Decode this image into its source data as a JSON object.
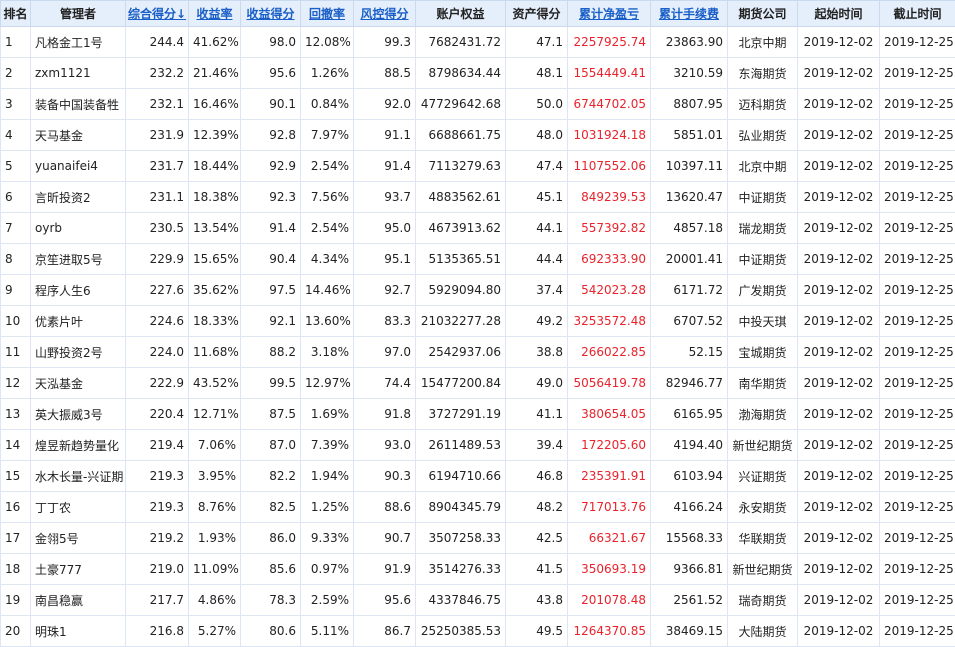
{
  "columns": [
    {
      "label": "排名",
      "sortable": false
    },
    {
      "label": "管理者",
      "sortable": false
    },
    {
      "label": "综合得分↓",
      "sortable": true
    },
    {
      "label": "收益率",
      "sortable": true
    },
    {
      "label": "收益得分",
      "sortable": true
    },
    {
      "label": "回撤率",
      "sortable": true
    },
    {
      "label": "风控得分",
      "sortable": true
    },
    {
      "label": "账户权益",
      "sortable": false
    },
    {
      "label": "资产得分",
      "sortable": false
    },
    {
      "label": "累计净盈亏",
      "sortable": true
    },
    {
      "label": "累计手续费",
      "sortable": true
    },
    {
      "label": "期货公司",
      "sortable": false
    },
    {
      "label": "起始时间",
      "sortable": false
    },
    {
      "label": "截止时间",
      "sortable": false
    }
  ],
  "rows": [
    [
      "1",
      "凡格金工1号",
      "244.4",
      "41.62%",
      "98.0",
      "12.08%",
      "99.3",
      "7682431.72",
      "47.1",
      "2257925.74",
      "23863.90",
      "北京中期",
      "2019-12-02",
      "2019-12-25"
    ],
    [
      "2",
      "zxm1121",
      "232.2",
      "21.46%",
      "95.6",
      "1.26%",
      "88.5",
      "8798634.44",
      "48.1",
      "1554449.41",
      "3210.59",
      "东海期货",
      "2019-12-02",
      "2019-12-25"
    ],
    [
      "3",
      "装备中国装备牲",
      "232.1",
      "16.46%",
      "90.1",
      "0.84%",
      "92.0",
      "47729642.68",
      "50.0",
      "6744702.05",
      "8807.95",
      "迈科期货",
      "2019-12-02",
      "2019-12-25"
    ],
    [
      "4",
      "天马基金",
      "231.9",
      "12.39%",
      "92.8",
      "7.97%",
      "91.1",
      "6688661.75",
      "48.0",
      "1031924.18",
      "5851.01",
      "弘业期货",
      "2019-12-02",
      "2019-12-25"
    ],
    [
      "5",
      "yuanaifei4",
      "231.7",
      "18.44%",
      "92.9",
      "2.54%",
      "91.4",
      "7113279.63",
      "47.4",
      "1107552.06",
      "10397.11",
      "北京中期",
      "2019-12-02",
      "2019-12-25"
    ],
    [
      "6",
      "言昕投资2",
      "231.1",
      "18.38%",
      "92.3",
      "7.56%",
      "93.7",
      "4883562.61",
      "45.1",
      "849239.53",
      "13620.47",
      "中证期货",
      "2019-12-02",
      "2019-12-25"
    ],
    [
      "7",
      "oyrb",
      "230.5",
      "13.54%",
      "91.4",
      "2.54%",
      "95.0",
      "4673913.62",
      "44.1",
      "557392.82",
      "4857.18",
      "瑞龙期货",
      "2019-12-02",
      "2019-12-25"
    ],
    [
      "8",
      "京笙进取5号",
      "229.9",
      "15.65%",
      "90.4",
      "4.34%",
      "95.1",
      "5135365.51",
      "44.4",
      "692333.90",
      "20001.41",
      "中证期货",
      "2019-12-02",
      "2019-12-25"
    ],
    [
      "9",
      "程序人生6",
      "227.6",
      "35.62%",
      "97.5",
      "14.46%",
      "92.7",
      "5929094.80",
      "37.4",
      "542023.28",
      "6171.72",
      "广发期货",
      "2019-12-02",
      "2019-12-25"
    ],
    [
      "10",
      "优素片叶",
      "224.6",
      "18.33%",
      "92.1",
      "13.60%",
      "83.3",
      "21032277.28",
      "49.2",
      "3253572.48",
      "6707.52",
      "中投天琪",
      "2019-12-02",
      "2019-12-25"
    ],
    [
      "11",
      "山野投资2号",
      "224.0",
      "11.68%",
      "88.2",
      "3.18%",
      "97.0",
      "2542937.06",
      "38.8",
      "266022.85",
      "52.15",
      "宝城期货",
      "2019-12-02",
      "2019-12-25"
    ],
    [
      "12",
      "天泓基金",
      "222.9",
      "43.52%",
      "99.5",
      "12.97%",
      "74.4",
      "15477200.84",
      "49.0",
      "5056419.78",
      "82946.77",
      "南华期货",
      "2019-12-02",
      "2019-12-25"
    ],
    [
      "13",
      "英大振威3号",
      "220.4",
      "12.71%",
      "87.5",
      "1.69%",
      "91.8",
      "3727291.19",
      "41.1",
      "380654.05",
      "6165.95",
      "渤海期货",
      "2019-12-02",
      "2019-12-25"
    ],
    [
      "14",
      "煌昱新趋势量化",
      "219.4",
      "7.06%",
      "87.0",
      "7.39%",
      "93.0",
      "2611489.53",
      "39.4",
      "172205.60",
      "4194.40",
      "新世纪期货",
      "2019-12-02",
      "2019-12-25"
    ],
    [
      "15",
      "水木长量-兴证期",
      "219.3",
      "3.95%",
      "82.2",
      "1.94%",
      "90.3",
      "6194710.66",
      "46.8",
      "235391.91",
      "6103.94",
      "兴证期货",
      "2019-12-02",
      "2019-12-25"
    ],
    [
      "16",
      "丁丁农",
      "219.3",
      "8.76%",
      "82.5",
      "1.25%",
      "88.6",
      "8904345.79",
      "48.2",
      "717013.76",
      "4166.24",
      "永安期货",
      "2019-12-02",
      "2019-12-25"
    ],
    [
      "17",
      "金翎5号",
      "219.2",
      "1.93%",
      "86.0",
      "9.33%",
      "90.7",
      "3507258.33",
      "42.5",
      "66321.67",
      "15568.33",
      "华联期货",
      "2019-12-02",
      "2019-12-25"
    ],
    [
      "18",
      "土豪777",
      "219.0",
      "11.09%",
      "85.6",
      "0.97%",
      "91.9",
      "3514276.33",
      "41.5",
      "350693.19",
      "9366.81",
      "新世纪期货",
      "2019-12-02",
      "2019-12-25"
    ],
    [
      "19",
      "南昌稳赢",
      "217.7",
      "4.86%",
      "78.3",
      "2.59%",
      "95.6",
      "4337846.75",
      "43.8",
      "201078.48",
      "2561.52",
      "瑞奇期货",
      "2019-12-02",
      "2019-12-25"
    ],
    [
      "20",
      "明珠1",
      "216.8",
      "5.27%",
      "80.6",
      "5.11%",
      "86.7",
      "25250385.53",
      "49.5",
      "1264370.85",
      "38469.15",
      "大陆期货",
      "2019-12-02",
      "2019-12-25"
    ]
  ],
  "colors": {
    "header_bg": "#e5eefb",
    "sort_link": "#1a5fc7",
    "net_pnl": "#e8232c"
  }
}
